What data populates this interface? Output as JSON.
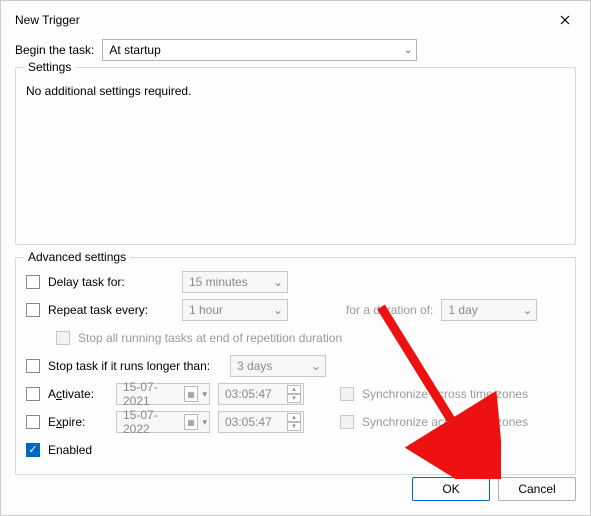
{
  "window": {
    "title": "New Trigger"
  },
  "begin": {
    "label": "Begin the task:",
    "value": "At startup"
  },
  "settings": {
    "title": "Settings",
    "message": "No additional settings required."
  },
  "advanced": {
    "title": "Advanced settings",
    "delay": {
      "label": "Delay task for:",
      "value": "15 minutes"
    },
    "repeat": {
      "label": "Repeat task every:",
      "value": "1 hour",
      "duration_label": "for a duration of:",
      "duration_value": "1 day"
    },
    "stop_repetition": "Stop all running tasks at end of repetition duration",
    "stop_long": {
      "label": "Stop task if it runs longer than:",
      "value": "3 days"
    },
    "activate": {
      "label_pre": "A",
      "label_u": "c",
      "label_post": "tivate:",
      "date": "15-07-2021",
      "time": "03:05:47",
      "sync": "Synchronize across time zones"
    },
    "expire": {
      "label_pre": "E",
      "label_u": "x",
      "label_post": "pire:",
      "date": "15-07-2022",
      "time": "03:05:47",
      "sync": "Synchronize across time zones"
    },
    "enabled": "Enabled"
  },
  "buttons": {
    "ok": "OK",
    "cancel": "Cancel"
  }
}
